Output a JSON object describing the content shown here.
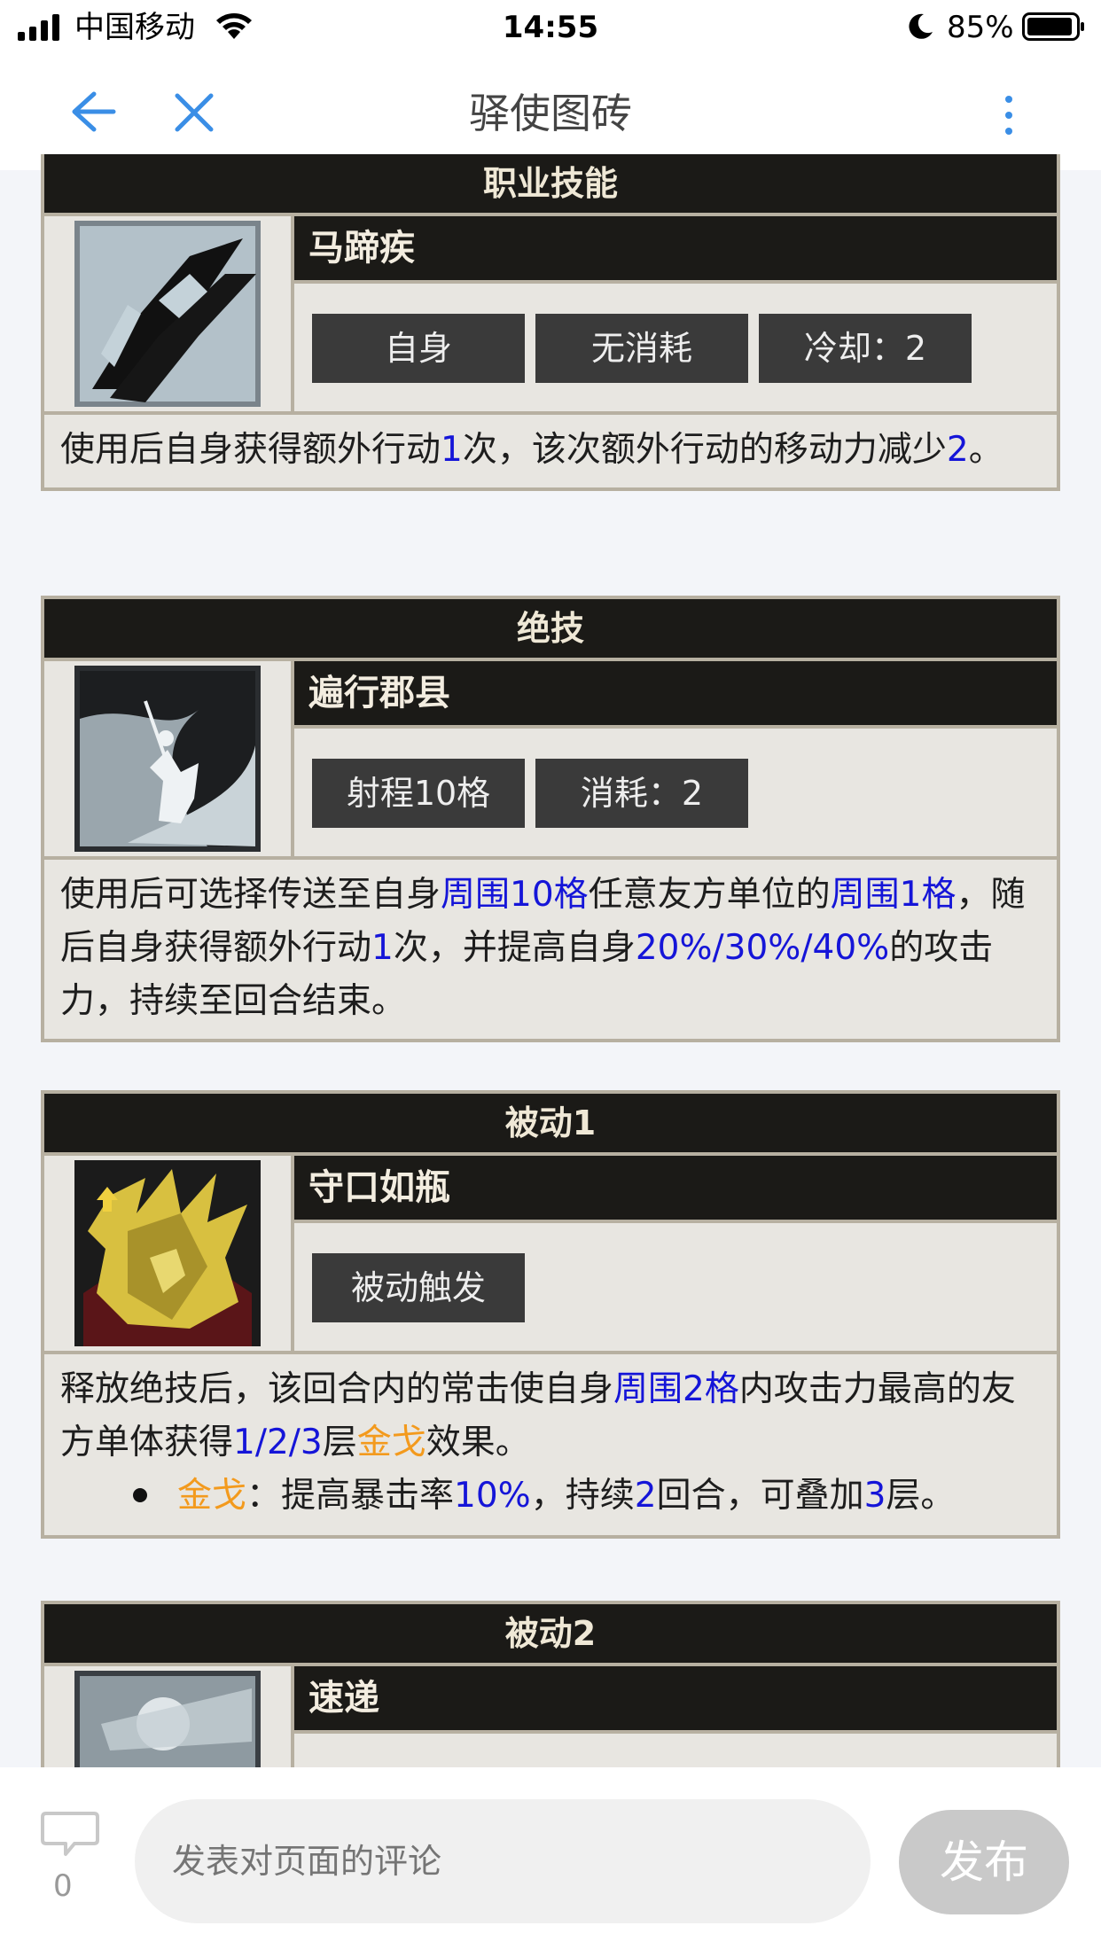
{
  "status_bar": {
    "carrier": "中国移动",
    "time": "14:55",
    "battery": "85%"
  },
  "nav": {
    "title": "驿使图砖"
  },
  "skills": [
    {
      "header": "职业技能",
      "name": "马蹄疾",
      "tags": [
        "自身",
        "无消耗",
        "冷却：2"
      ],
      "desc": [
        {
          "t": "使用后自身获得额外行动"
        },
        {
          "t": "1",
          "c": "blue"
        },
        {
          "t": "次，该次额外行动的移动力减少"
        },
        {
          "t": "2",
          "c": "blue"
        },
        {
          "t": "。"
        }
      ]
    },
    {
      "header": "绝技",
      "name": "遍行郡县",
      "tags": [
        "射程10格",
        "消耗：2"
      ],
      "desc": [
        {
          "t": "使用后可选择传送至自身"
        },
        {
          "t": "周围10格",
          "c": "blue"
        },
        {
          "t": "任意友方单位的"
        },
        {
          "t": "周围1格",
          "c": "blue"
        },
        {
          "t": "，随后自身获得额外行动"
        },
        {
          "t": "1",
          "c": "blue"
        },
        {
          "t": "次，并提高自身"
        },
        {
          "t": "20%/30%/40%",
          "c": "blue"
        },
        {
          "t": "的攻击力，持续至回合结束。"
        }
      ]
    },
    {
      "header": "被动1",
      "name": "守口如瓶",
      "tags": [
        "被动触发"
      ],
      "desc": [
        {
          "t": "释放绝技后，该回合内的常击使自身"
        },
        {
          "t": "周围2格",
          "c": "blue"
        },
        {
          "t": "内攻击力最高的友方单体获得"
        },
        {
          "t": "1/2/3",
          "c": "blue"
        },
        {
          "t": "层"
        },
        {
          "t": "金戈",
          "c": "orange"
        },
        {
          "t": "效果。"
        }
      ],
      "bullet": [
        {
          "t": "金戈",
          "c": "orange"
        },
        {
          "t": "：提高暴击率"
        },
        {
          "t": "10%",
          "c": "blue"
        },
        {
          "t": "，持续"
        },
        {
          "t": "2",
          "c": "blue"
        },
        {
          "t": "回合，可叠加"
        },
        {
          "t": "3",
          "c": "blue"
        },
        {
          "t": "层。"
        }
      ]
    },
    {
      "header": "被动2",
      "name": "速递",
      "tags": []
    }
  ],
  "icons": {
    "skill1": "armor-slash-icon",
    "skill2": "horse-rider-icon",
    "skill3": "golden-shield-flame-icon",
    "skill4": "rider-portrait-icon"
  },
  "comment_bar": {
    "count": "0",
    "placeholder": "发表对页面的评论",
    "publish": "发布"
  },
  "colors": {
    "header_bg": "#1b1a17",
    "card_bg": "#e8e6e1",
    "border": "#b7b0a1",
    "highlight_blue": "#1515d8",
    "highlight_orange": "#f39a1d",
    "accent_blue": "#3a8ee6"
  }
}
